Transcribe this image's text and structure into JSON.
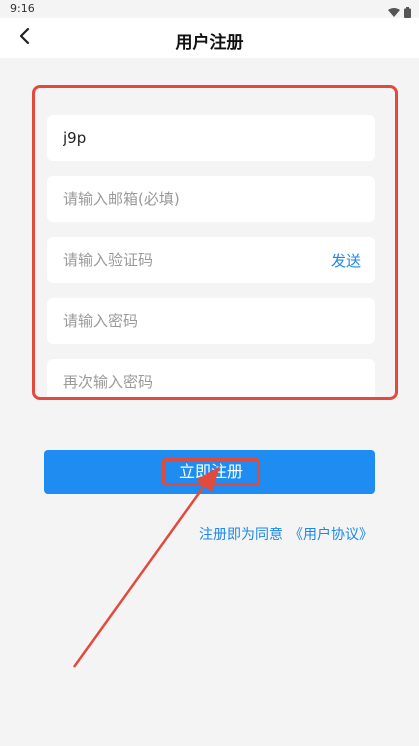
{
  "status_bar": {
    "time": "9:16"
  },
  "header": {
    "title": "用户注册"
  },
  "form": {
    "username_value": "j9p",
    "email_placeholder": "请输入邮箱(必填)",
    "code_placeholder": "请输入验证码",
    "send_label": "发送",
    "password_placeholder": "请输入密码",
    "confirm_placeholder": "再次输入密码"
  },
  "actions": {
    "register_label": "立即注册"
  },
  "agreement": {
    "text": "注册即为同意",
    "link": "《用户协议》"
  },
  "colors": {
    "accent": "#1e8cf0",
    "link": "#1b88ee",
    "annotation": "#e24a3d"
  }
}
